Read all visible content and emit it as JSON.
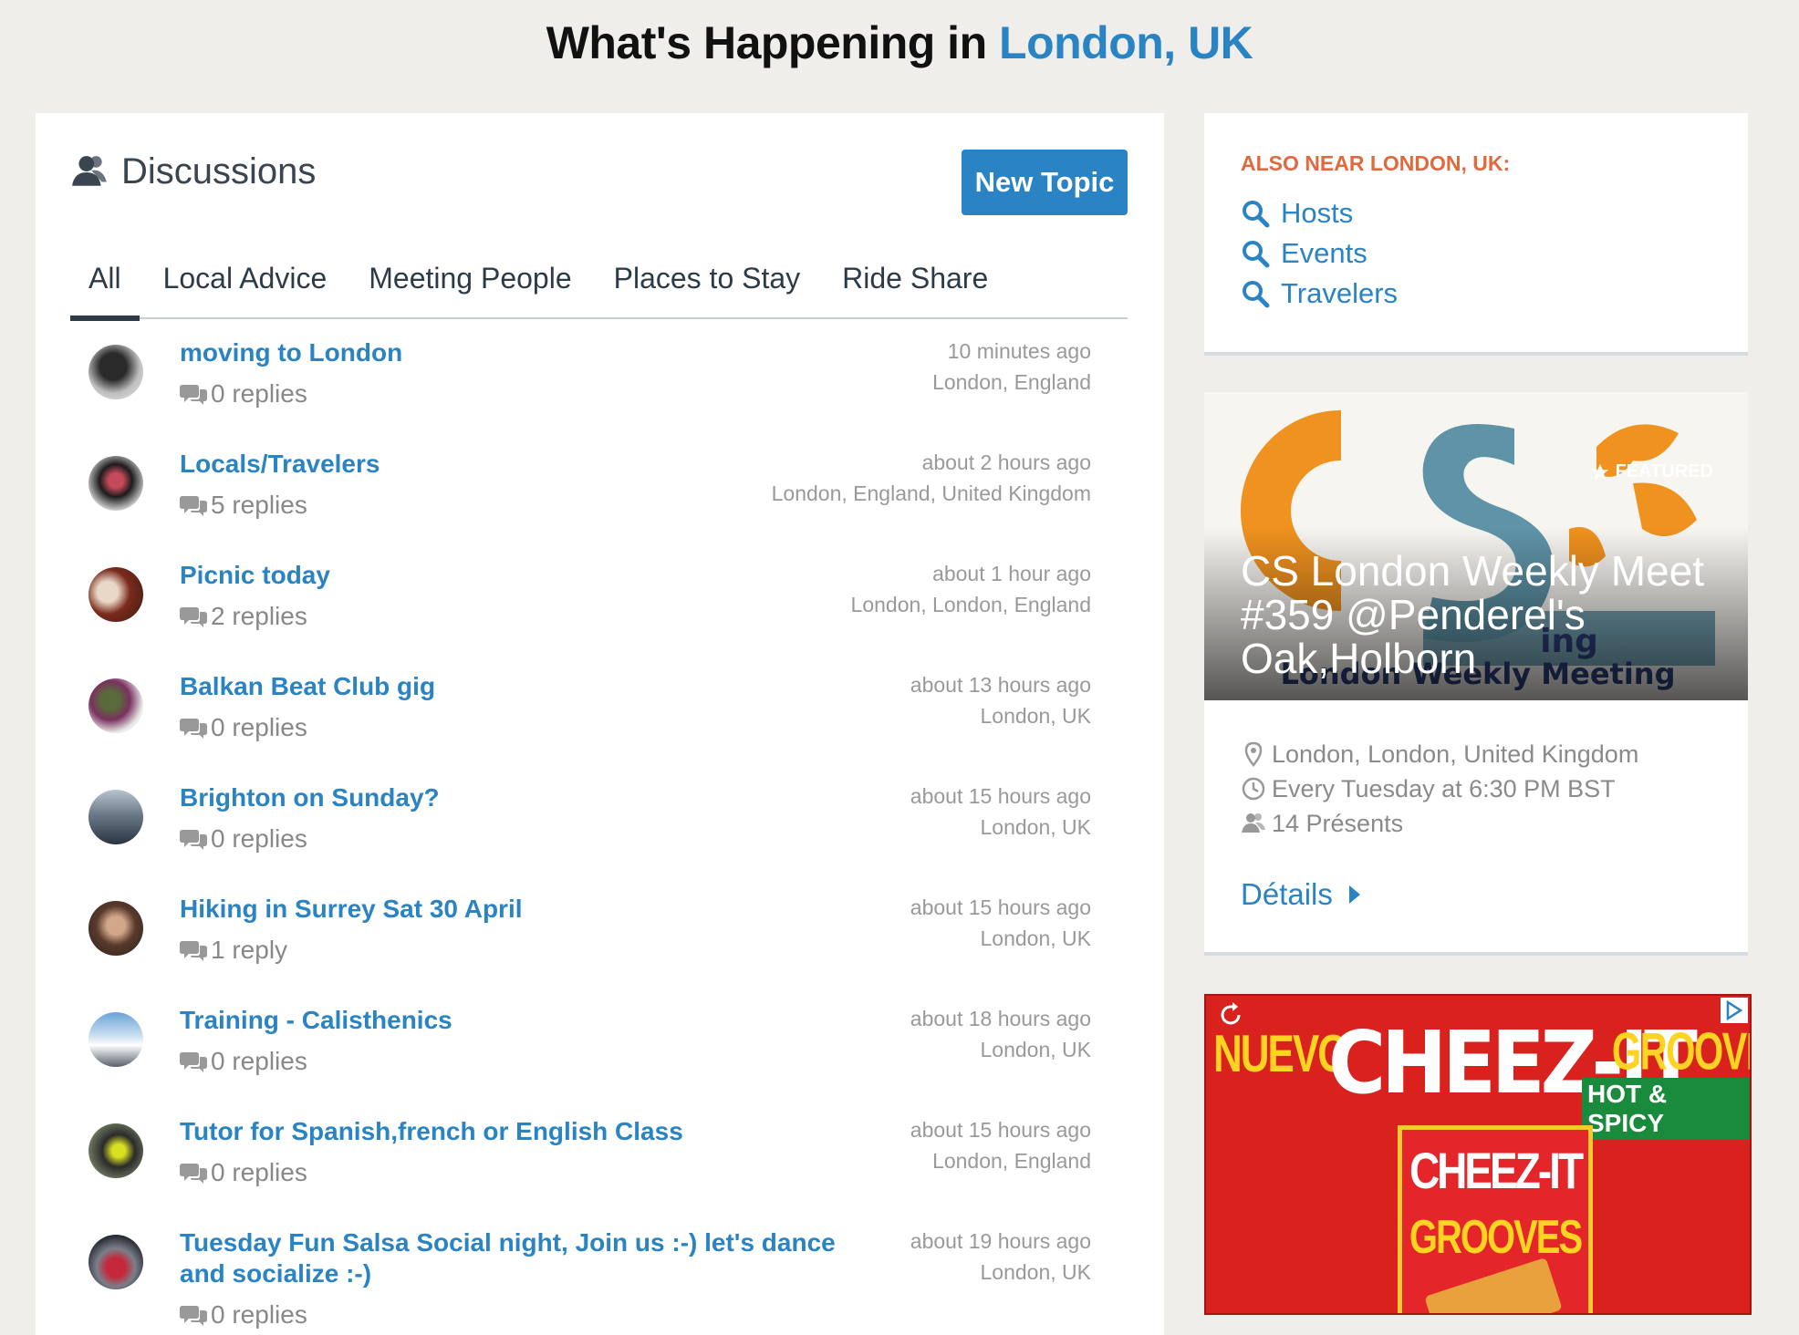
{
  "header": {
    "prefix": "What's Happening in",
    "city": "London, UK"
  },
  "discussions": {
    "title": "Discussions",
    "new_topic_label": "New Topic",
    "tabs": [
      {
        "label": "All",
        "active": true
      },
      {
        "label": "Local Advice"
      },
      {
        "label": "Meeting People"
      },
      {
        "label": "Places to Stay"
      },
      {
        "label": "Ride Share"
      }
    ],
    "topics": [
      {
        "title": "moving to London",
        "replies": "0 replies",
        "time": "10 minutes ago",
        "location": "London, England"
      },
      {
        "title": "Locals/Travelers",
        "replies": "5 replies",
        "time": "about 2 hours ago",
        "location": "London, England, United Kingdom"
      },
      {
        "title": "Picnic today",
        "replies": "2 replies",
        "time": "about 1 hour ago",
        "location": "London, London, England"
      },
      {
        "title": "Balkan Beat Club gig",
        "replies": "0 replies",
        "time": "about 13 hours ago",
        "location": "London, UK"
      },
      {
        "title": "Brighton on Sunday?",
        "replies": "0 replies",
        "time": "about 15 hours ago",
        "location": "London, UK"
      },
      {
        "title": "Hiking in Surrey Sat 30 April",
        "replies": "1 reply",
        "time": "about 15 hours ago",
        "location": "London, UK"
      },
      {
        "title": "Training - Calisthenics",
        "replies": "0 replies",
        "time": "about 18 hours ago",
        "location": "London, UK"
      },
      {
        "title": "Tutor for Spanish,french or English Class",
        "replies": "0 replies",
        "time": "about 15 hours ago",
        "location": "London, England"
      },
      {
        "title": "Tuesday Fun Salsa Social night, Join us :-) let's dance and socialize :-)",
        "replies": "0 replies",
        "time": "about 19 hours ago",
        "location": "London, UK"
      }
    ]
  },
  "sidebar": {
    "near_label": "ALSO NEAR LONDON, UK:",
    "links": [
      "Hosts",
      "Events",
      "Travelers"
    ],
    "event": {
      "featured_label": "FEATURED",
      "name": "CS London Weekly Meet #359 @Penderel's Oak,Holborn",
      "location": "London, London, United Kingdom",
      "schedule": "Every Tuesday at 6:30 PM BST",
      "attendees": "14 Présents",
      "details_label": "Détails"
    },
    "ad": {
      "nuevo": "NUEVO",
      "brand": "CHEEZ-IT",
      "product": "GROOVES",
      "flavor": "HOT & SPICY",
      "box_brand": "CHEEZ-IT",
      "box_product": "GROOVES"
    }
  },
  "colors": {
    "accent": "#2a83c3",
    "near_label": "#e0693d",
    "background": "#efeeeb"
  }
}
